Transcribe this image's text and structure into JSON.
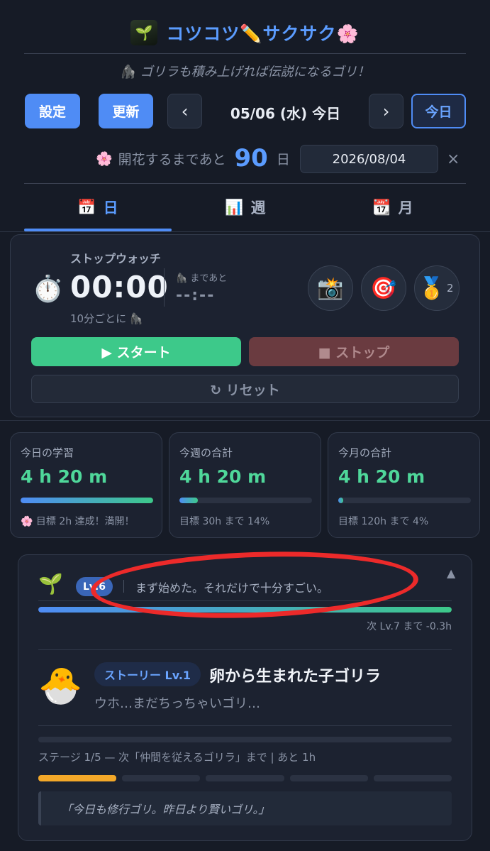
{
  "header": {
    "app_title": "コツコツ✏️サクサク🌸",
    "logo_icon": "🌱",
    "tagline": "🦍 ゴリラも積み上げれば伝説になるゴリ！"
  },
  "toolbar": {
    "settings_label": "設定",
    "refresh_label": "更新",
    "prev_label": "‹",
    "date_label": "05/06 (水) 今日",
    "next_label": "›",
    "today_label": "今日"
  },
  "countdown": {
    "icon": "🌸",
    "prefix": "開花するまであと",
    "days": "90",
    "suffix": "日",
    "target_date": "2026/08/04",
    "clear_label": "×"
  },
  "tabs": [
    {
      "icon": "📅",
      "label": "日",
      "active": true
    },
    {
      "icon": "📊",
      "label": "週",
      "active": false
    },
    {
      "icon": "📆",
      "label": "月",
      "active": false
    }
  ],
  "stopwatch": {
    "title": "ストップウォッチ",
    "icon": "⏱️",
    "time": "00:00",
    "interval_note": "10分ごとに 🦍",
    "remaining_label": "🦍 まであと",
    "remaining_value": "--:--",
    "actions": [
      {
        "name": "camera-icon",
        "glyph": "📸"
      },
      {
        "name": "target-icon",
        "glyph": "🎯"
      },
      {
        "name": "medal-icon",
        "glyph": "🥇"
      }
    ],
    "medal_count": "2",
    "start_label": "▶ スタート",
    "stop_label": "■ ストップ",
    "reset_label": "↻ リセット"
  },
  "stats": [
    {
      "label": "今日の学習",
      "value": "4 h 20 m",
      "progress": 1.0,
      "note": "🌸 目標 2h 達成！満開！"
    },
    {
      "label": "今週の合計",
      "value": "4 h 20 m",
      "progress": 0.14,
      "note": "目標 30h まで 14%"
    },
    {
      "label": "今月の合計",
      "value": "4 h 20 m",
      "progress": 0.04,
      "note": "目標 120h まで 4%"
    }
  ],
  "level": {
    "icon": "🌱",
    "badge": "Lv.6",
    "message": "まず始めた。それだけで十分すごい。",
    "progress": 1.0,
    "next_label": "次 Lv.7 まで -0.3h",
    "collapse_icon": "▲"
  },
  "story": {
    "icon": "🐣",
    "badge": "ストーリー Lv.1",
    "title": "卵から生まれた子ゴリラ",
    "line": "ウホ…まだちっちゃいゴリ…",
    "stage_text": "ステージ 1/5 — 次「仲間を従えるゴリラ」まで | あと 1h",
    "stage_current": 1,
    "stage_total": 5,
    "quote": "「今日も修行ゴリ。昨日より賢いゴリ。」"
  },
  "colors": {
    "accent": "#4f8cf5",
    "success": "#3dc98a",
    "stage": "#f3a829",
    "annotation": "#ec2a2a"
  }
}
